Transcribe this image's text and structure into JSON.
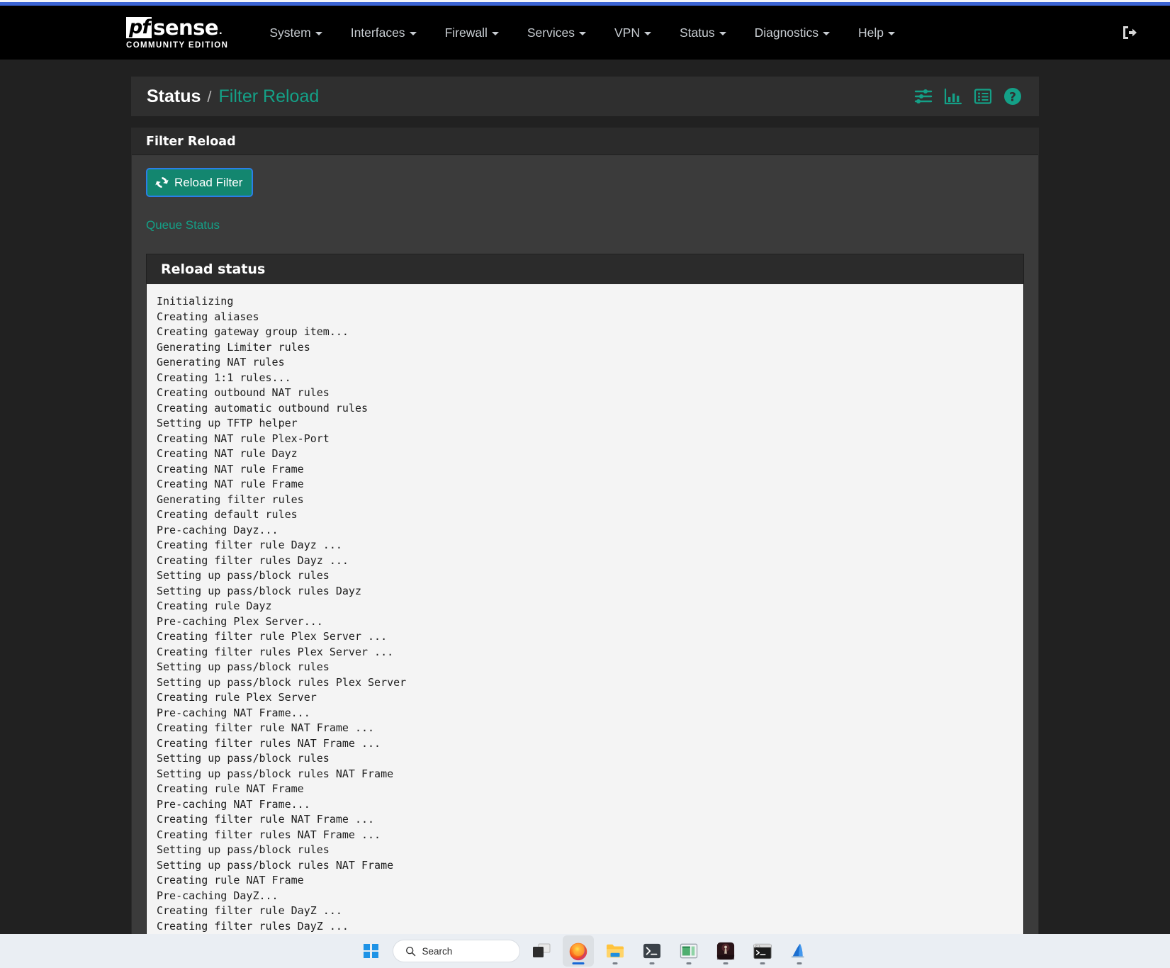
{
  "browser": {
    "accent_color": "#3b64d4"
  },
  "navbar": {
    "brand": {
      "pf": "pf",
      "sense": "sense",
      "subtitle": "COMMUNITY EDITION"
    },
    "items": [
      {
        "label": "System",
        "has_caret": true
      },
      {
        "label": "Interfaces",
        "has_caret": true
      },
      {
        "label": "Firewall",
        "has_caret": true
      },
      {
        "label": "Services",
        "has_caret": true
      },
      {
        "label": "VPN",
        "has_caret": true
      },
      {
        "label": "Status",
        "has_caret": true
      },
      {
        "label": "Diagnostics",
        "has_caret": true
      },
      {
        "label": "Help",
        "has_caret": true
      }
    ],
    "logout_icon": "logout-icon"
  },
  "breadcrumb": {
    "parent": "Status",
    "separator": "/",
    "current": "Filter Reload"
  },
  "header_icons": [
    {
      "name": "sliders-icon",
      "color": "#14a087"
    },
    {
      "name": "bar-chart-icon",
      "color": "#14a087"
    },
    {
      "name": "list-table-icon",
      "color": "#14a087"
    },
    {
      "name": "help-circle-icon",
      "color": "#14a087"
    }
  ],
  "panel": {
    "title": "Filter Reload",
    "reload_button": {
      "label": "Reload Filter",
      "icon": "refresh-icon",
      "bg": "#13866f",
      "focus_ring": "#2a7fe8"
    },
    "queue_status_link": "Queue Status"
  },
  "reload_status": {
    "title": "Reload status",
    "lines": [
      "Initializing",
      "Creating aliases",
      "Creating gateway group item...",
      "Generating Limiter rules",
      "Generating NAT rules",
      "Creating 1:1 rules...",
      "Creating outbound NAT rules",
      "Creating automatic outbound rules",
      "Setting up TFTP helper",
      "Creating NAT rule Plex-Port",
      "Creating NAT rule Dayz",
      "Creating NAT rule Frame",
      "Creating NAT rule Frame",
      "Generating filter rules",
      "Creating default rules",
      "Pre-caching Dayz...",
      "Creating filter rule Dayz ...",
      "Creating filter rules Dayz ...",
      "Setting up pass/block rules",
      "Setting up pass/block rules Dayz",
      "Creating rule Dayz",
      "Pre-caching Plex Server...",
      "Creating filter rule Plex Server ...",
      "Creating filter rules Plex Server ...",
      "Setting up pass/block rules",
      "Setting up pass/block rules Plex Server",
      "Creating rule Plex Server",
      "Pre-caching NAT Frame...",
      "Creating filter rule NAT Frame ...",
      "Creating filter rules NAT Frame ...",
      "Setting up pass/block rules",
      "Setting up pass/block rules NAT Frame",
      "Creating rule NAT Frame",
      "Pre-caching NAT Frame...",
      "Creating filter rule NAT Frame ...",
      "Creating filter rules NAT Frame ...",
      "Setting up pass/block rules",
      "Setting up pass/block rules NAT Frame",
      "Creating rule NAT Frame",
      "Pre-caching DayZ...",
      "Creating filter rule DayZ ...",
      "Creating filter rules DayZ ..."
    ]
  },
  "taskbar": {
    "start_button": "windows-start-icon",
    "search": {
      "label": "Search",
      "icon": "search-icon"
    },
    "items": [
      {
        "name": "task-view-icon",
        "label": "Task View",
        "active": false
      },
      {
        "name": "firefox-icon",
        "label": "Firefox",
        "active": true
      },
      {
        "name": "file-explorer-icon",
        "label": "File Explorer",
        "active": false
      },
      {
        "name": "terminal-icon",
        "label": "Windows Terminal",
        "active": false
      },
      {
        "name": "remote-desktop-icon",
        "label": "Remote Desktop",
        "active": false
      },
      {
        "name": "game-icon",
        "label": "Game",
        "active": false
      },
      {
        "name": "command-prompt-icon",
        "label": "Command Prompt",
        "active": false
      },
      {
        "name": "wireshark-icon",
        "label": "Wireshark",
        "active": false
      }
    ]
  }
}
